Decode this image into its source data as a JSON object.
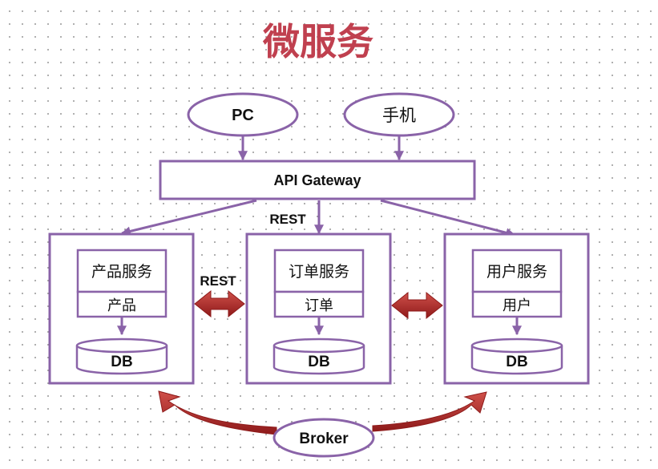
{
  "title": "微服务",
  "clients": [
    {
      "label": "PC"
    },
    {
      "label": "手机"
    }
  ],
  "gateway": {
    "label": "API Gateway"
  },
  "gateway_protocol": "REST",
  "inter_service_protocol": "REST",
  "services": [
    {
      "service_label": "产品服务",
      "domain_label": "产品",
      "db_label": "DB"
    },
    {
      "service_label": "订单服务",
      "domain_label": "订单",
      "db_label": "DB"
    },
    {
      "service_label": "用户服务",
      "domain_label": "用户",
      "db_label": "DB"
    }
  ],
  "broker": {
    "label": "Broker"
  },
  "colors": {
    "title": "#c0404f",
    "outline": "#8a63a8",
    "arrow_red": "#a8201f"
  }
}
